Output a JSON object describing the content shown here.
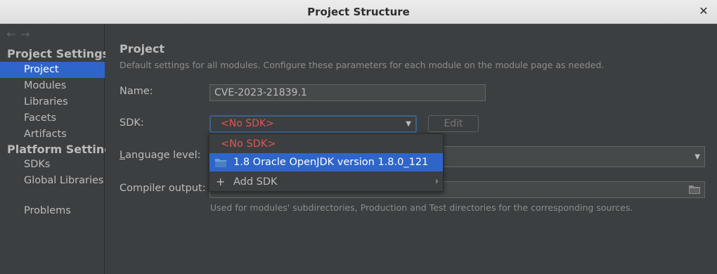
{
  "window": {
    "title": "Project Structure",
    "close_icon": "close-icon"
  },
  "sidebar": {
    "back_icon": "arrow-left-icon",
    "forward_icon": "arrow-right-icon",
    "section_project": "Project Settings",
    "project_items": [
      "Project",
      "Modules",
      "Libraries",
      "Facets",
      "Artifacts"
    ],
    "section_platform": "Platform Settings",
    "platform_items": [
      "SDKs",
      "Global Libraries"
    ],
    "other_items": [
      "Problems"
    ],
    "selected": "Project"
  },
  "main": {
    "heading": "Project",
    "description": "Default settings for all modules. Configure these parameters for each module on the module page as needed.",
    "name_label": "Name:",
    "name_value": "CVE-2023-21839.1",
    "sdk_label": "SDK:",
    "sdk_value": "<No SDK>",
    "edit_label": "Edit",
    "language_label": "Language level:",
    "compiler_label": "Compiler output:",
    "compiler_hint": "Used for modules' subdirectories, Production and Test directories for the corresponding sources."
  },
  "sdk_popup": {
    "items": [
      "<No SDK>",
      "1.8 Oracle OpenJDK version 1.8.0_121",
      "Add SDK"
    ],
    "selected": "1.8 Oracle OpenJDK version 1.8.0_121"
  },
  "colors": {
    "accent": "#2f65ca",
    "error": "#e05555",
    "background": "#3c3f41"
  }
}
